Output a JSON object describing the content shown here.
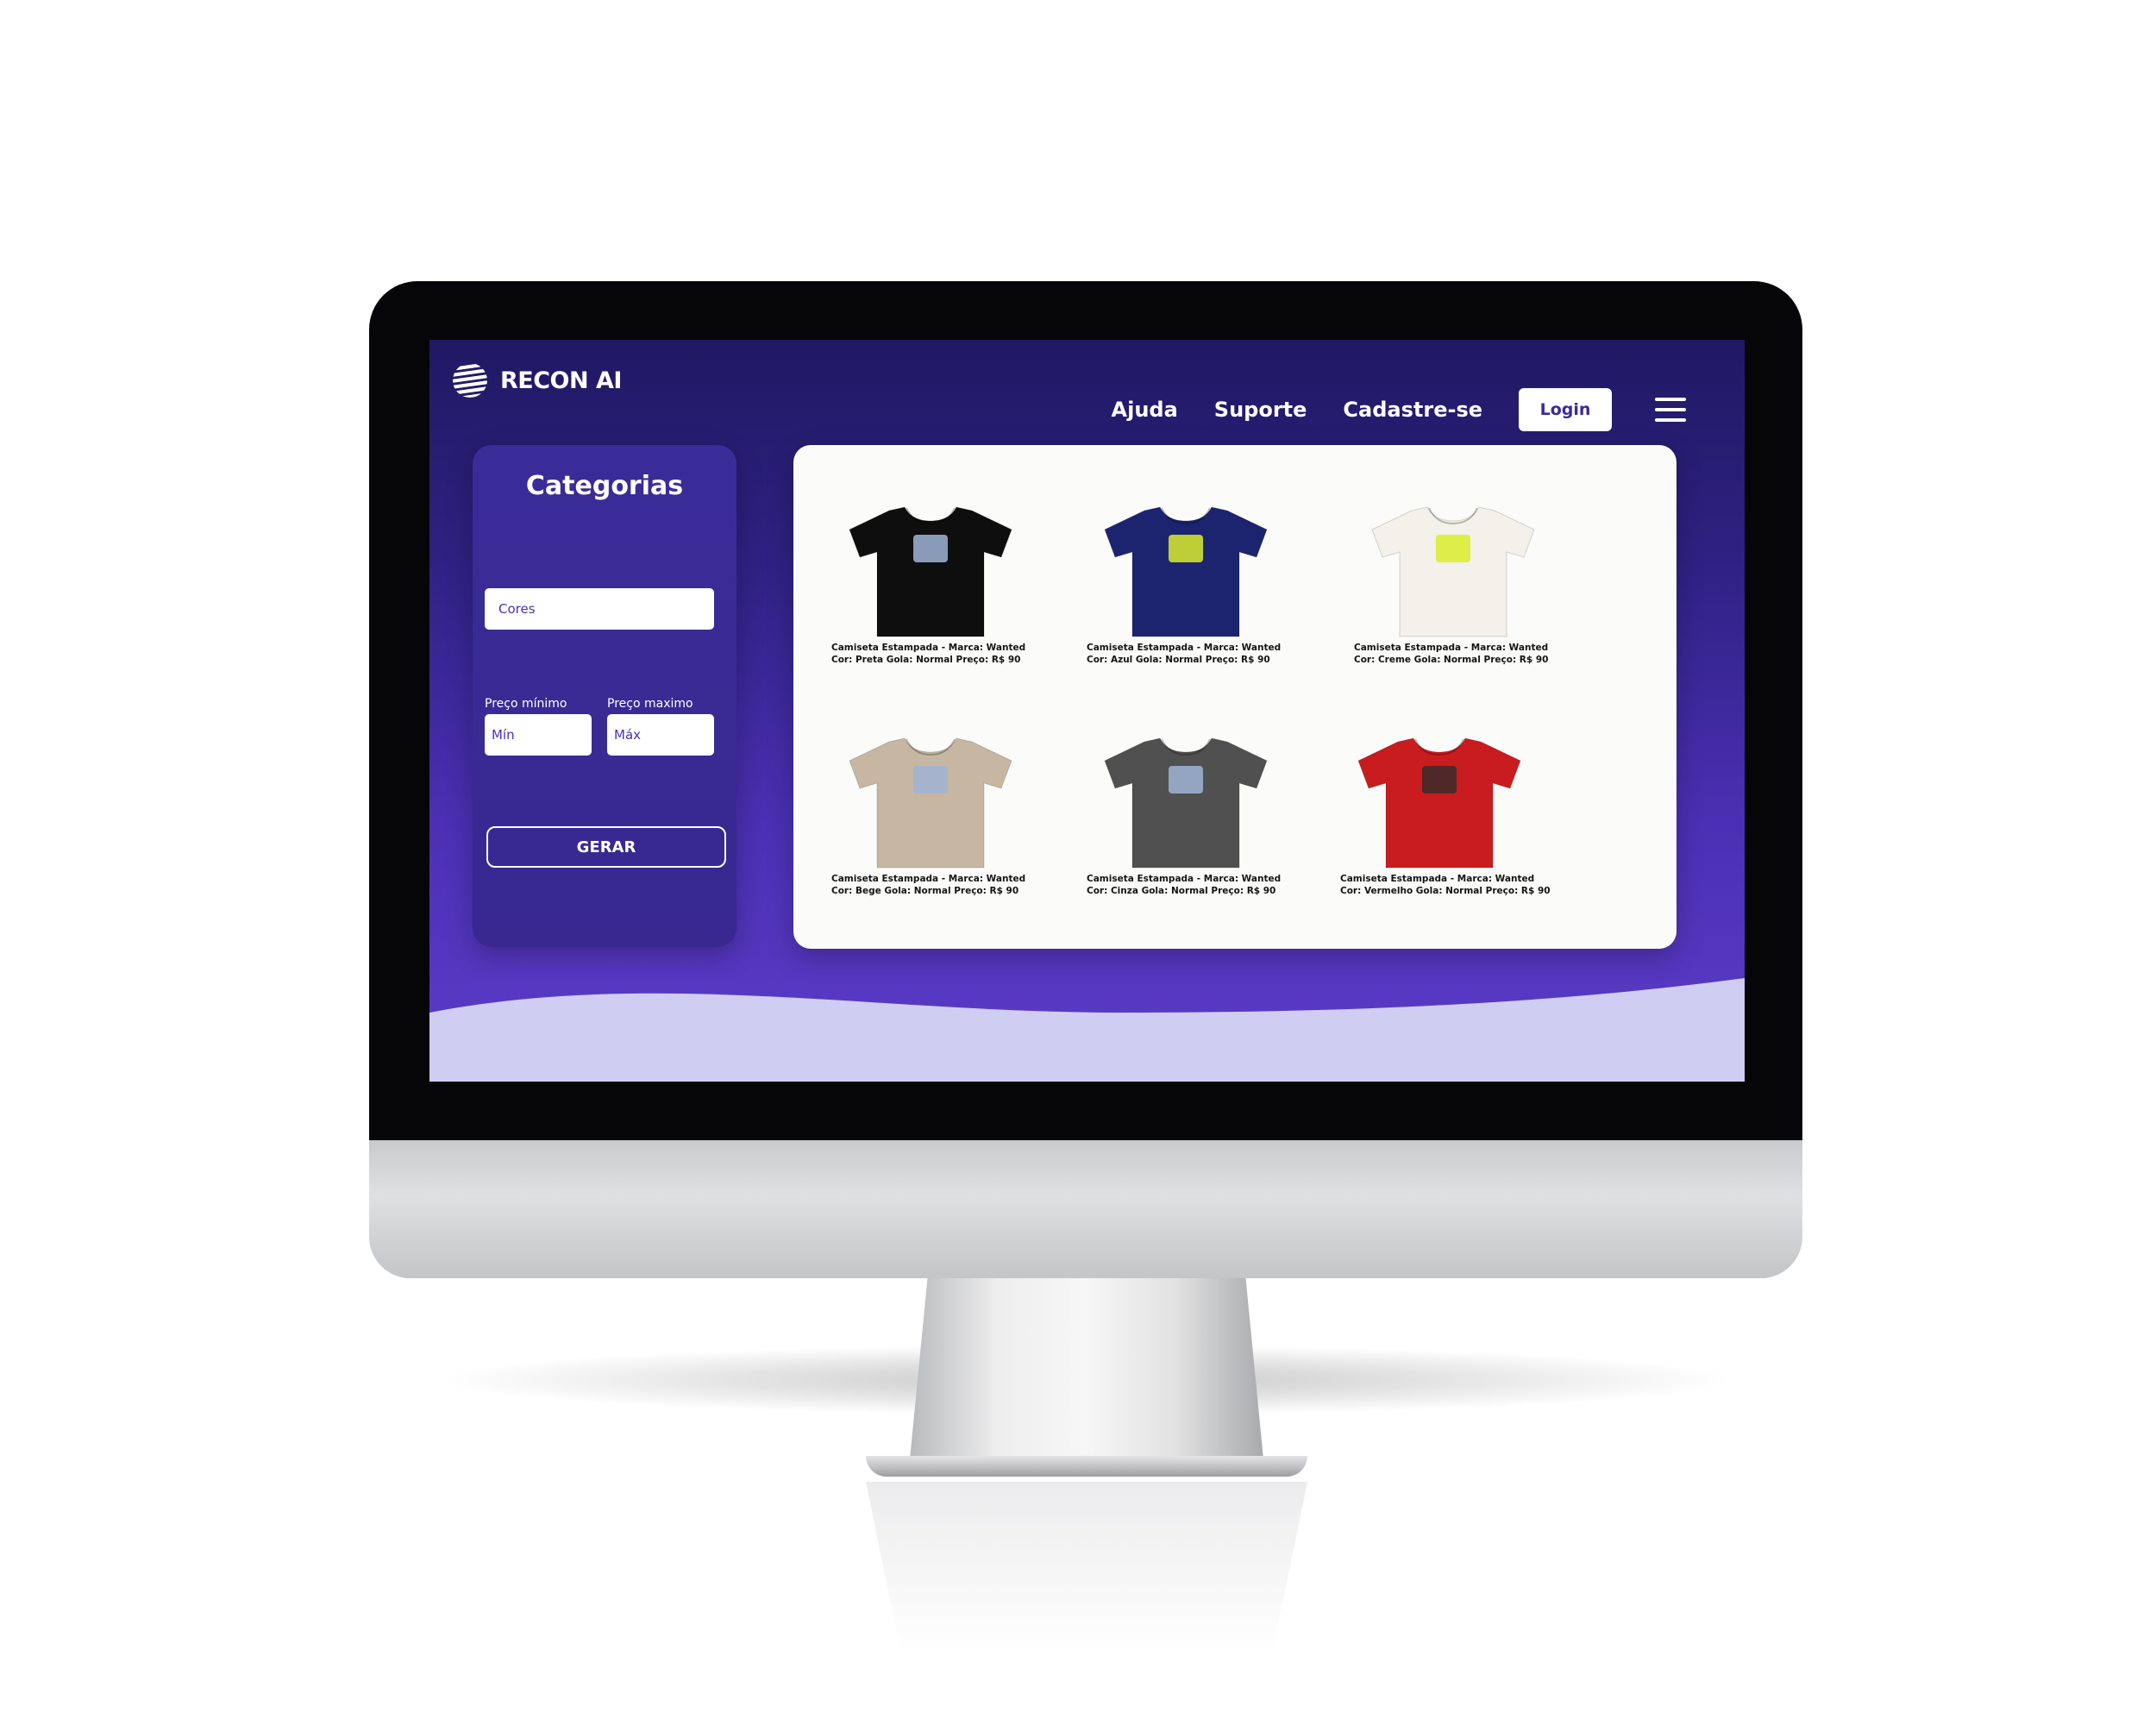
{
  "brand": {
    "name": "RECON AI"
  },
  "nav": {
    "links": [
      "Ajuda",
      "Suporte",
      "Cadastre-se"
    ],
    "login_label": "Login"
  },
  "sidebar": {
    "title": "Categorias",
    "colors_placeholder": "Cores",
    "min_price_label": "Preço mínimo",
    "max_price_label": "Preço maximo",
    "min_placeholder": "Mín",
    "max_placeholder": "Máx",
    "generate_label": "GERAR"
  },
  "products": [
    {
      "line1": "Camiseta Estampada - Marca: Wanted",
      "line2": "Cor: Preta  Gola: Normal  Preço: R$ 90",
      "color": "#0e0e0e"
    },
    {
      "line1": "Camiseta Estampada - Marca: Wanted",
      "line2": "Cor: Azul  Gola: Normal  Preço: R$ 90",
      "color": "#1c2470"
    },
    {
      "line1": "Camiseta Estampada - Marca: Wanted",
      "line2": "Cor: Creme  Gola: Normal  Preço: R$ 90",
      "color": "#f3f1ea"
    },
    {
      "line1": "Camiseta Estampada - Marca: Wanted",
      "line2": "Cor: Bege  Gola: Normal  Preço: R$ 90",
      "color": "#c6b6a2"
    },
    {
      "line1": "Camiseta Estampada - Marca: Wanted",
      "line2": "Cor: Cinza  Gola: Normal  Preço: R$ 90",
      "color": "#505050"
    },
    {
      "line1": "Camiseta Estampada - Marca: Wanted",
      "line2": "Cor: Vermelho  Gola: Normal  Preço: R$ 90",
      "color": "#c91c1f"
    }
  ],
  "theme": {
    "accent": "#3a2a9e",
    "wave": "#d0cdf3"
  },
  "icons": {
    "logo": "globe-stripes-icon",
    "menu": "hamburger-menu-icon"
  }
}
